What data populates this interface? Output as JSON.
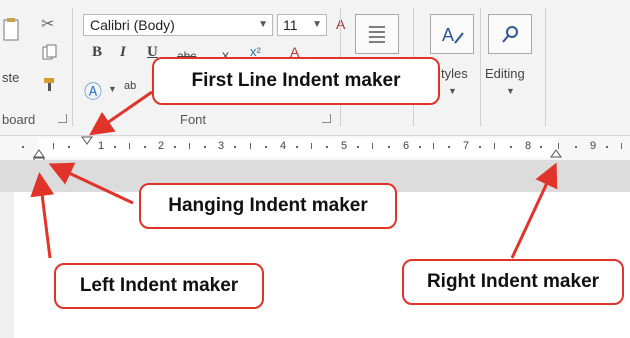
{
  "ribbon": {
    "clipboard": {
      "paste_label_partial": "ste",
      "group_label_partial": "board"
    },
    "font": {
      "font_name": "Calibri (Body)",
      "font_size": "11",
      "bold": "B",
      "italic": "I",
      "underline": "U",
      "strike_partial": "abc",
      "subscript_partial": "x",
      "superscript_partial": "x²",
      "highlight_partial": "ab",
      "group_label": "Font"
    },
    "styles": {
      "label_partial": "tyles"
    },
    "editing": {
      "label": "Editing"
    }
  },
  "ruler": {
    "numbers": [
      "1",
      "2",
      "3",
      "4",
      "5",
      "6",
      "7",
      "8",
      "9"
    ]
  },
  "callouts": {
    "first_line": "First Line Indent maker",
    "hanging": "Hanging Indent maker",
    "left": "Left Indent maker",
    "right": "Right Indent maker"
  },
  "colors": {
    "callout_border": "#e0342a",
    "arrow": "#e0342a"
  },
  "icons": [
    "paste-icon",
    "cut-icon",
    "copy-icon",
    "format-painter-icon",
    "text-effects-icon",
    "clear-formatting-icon",
    "paragraph-icon",
    "styles-icon",
    "find-icon",
    "dialog-launcher-icon",
    "dropdown-arrow-icon"
  ]
}
